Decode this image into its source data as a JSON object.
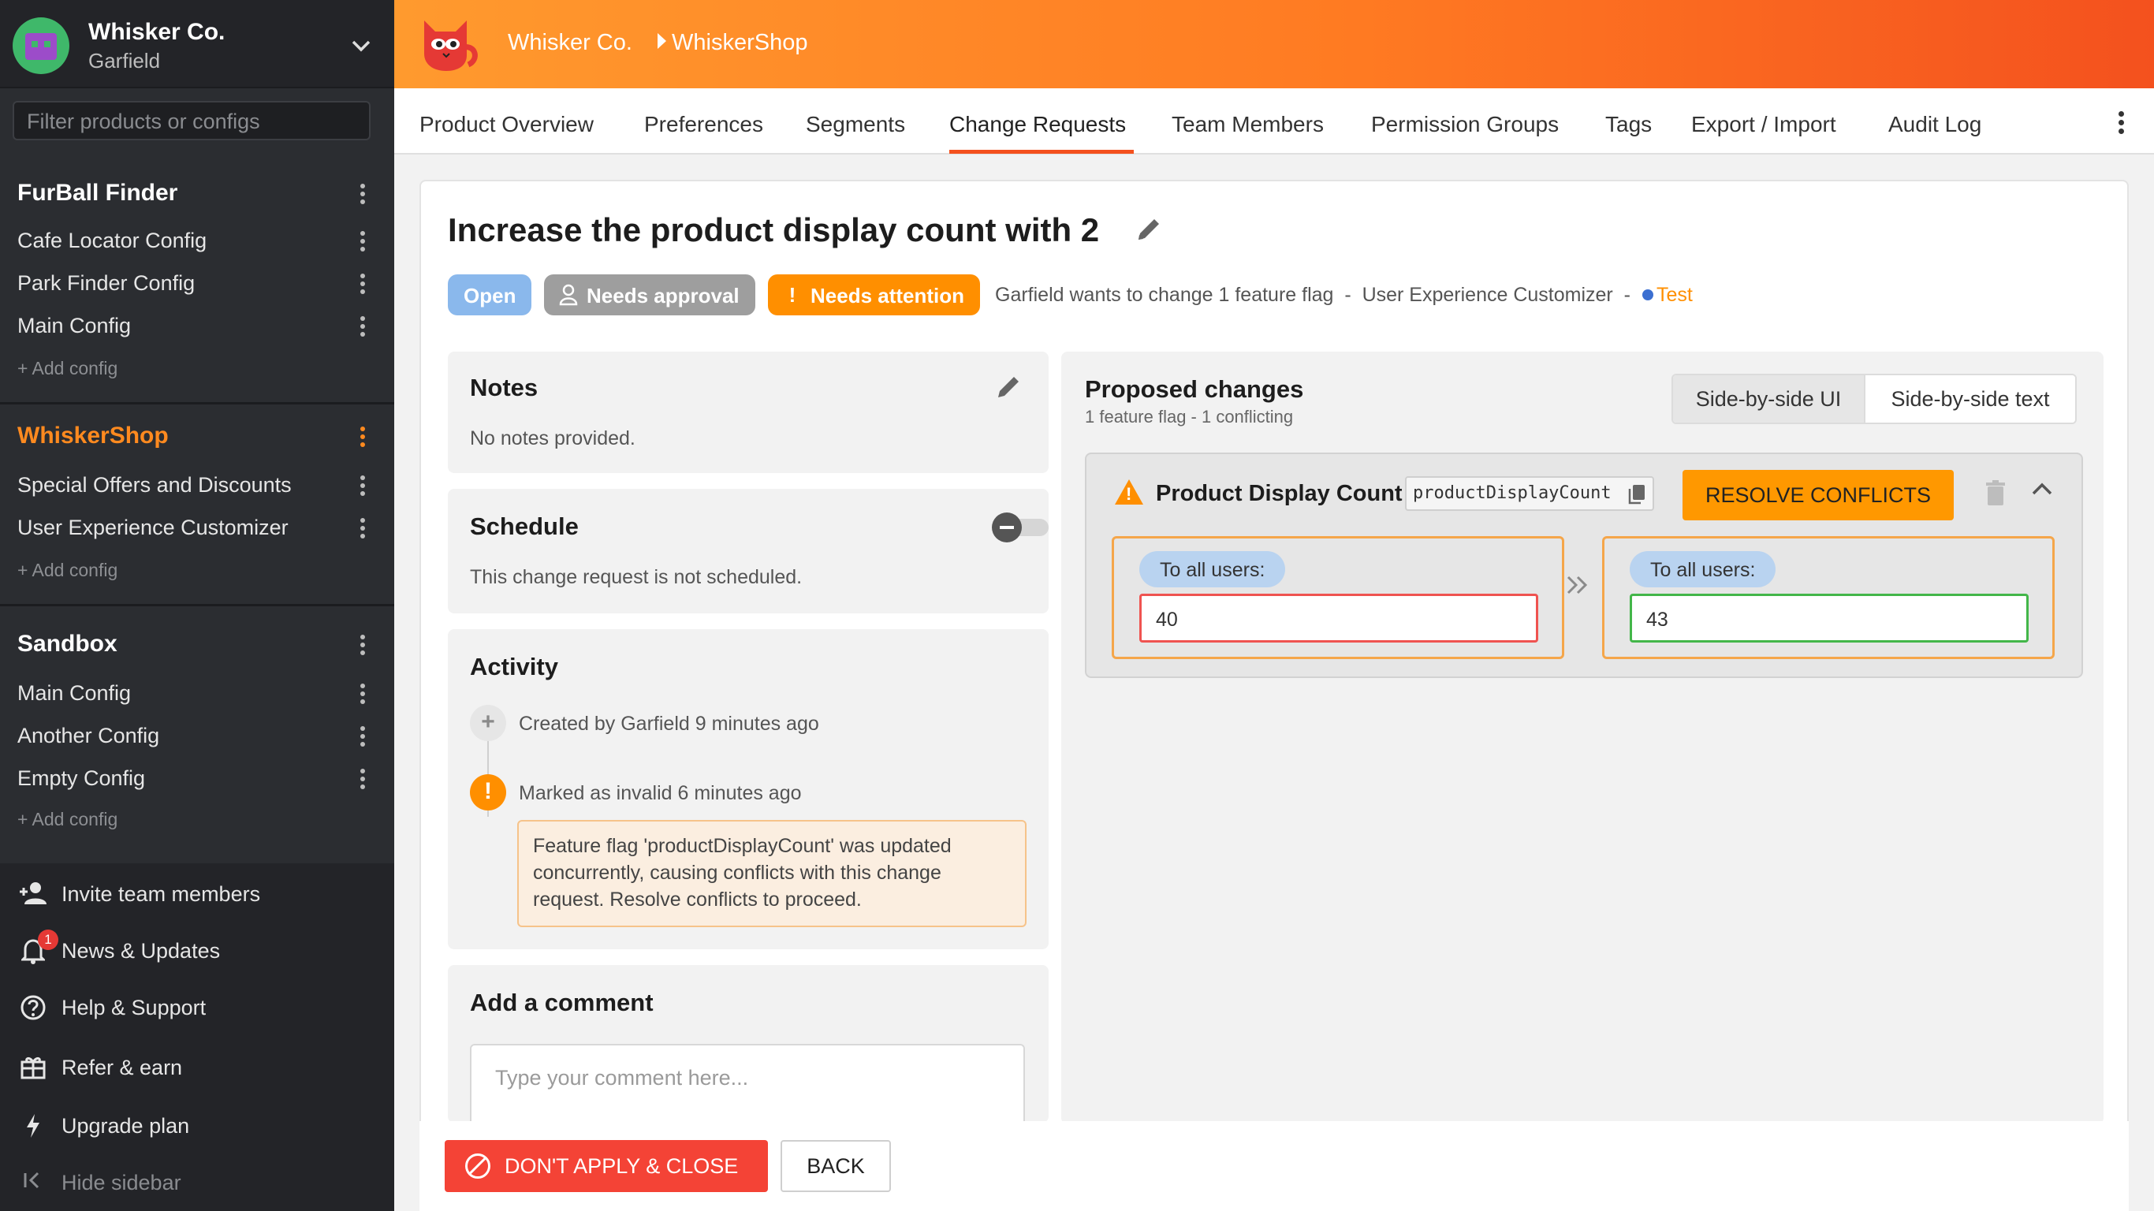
{
  "sidebar": {
    "org_name": "Whisker Co.",
    "user_name": "Garfield",
    "filter_placeholder": "Filter products or configs",
    "products": [
      {
        "name": "FurBall Finder",
        "active": false,
        "configs": [
          "Cafe Locator Config",
          "Park Finder Config",
          "Main Config"
        ],
        "add_label": "+ Add config"
      },
      {
        "name": "WhiskerShop",
        "active": true,
        "configs": [
          "Special Offers and Discounts",
          "User Experience Customizer"
        ],
        "add_label": "+ Add config"
      },
      {
        "name": "Sandbox",
        "active": false,
        "configs": [
          "Main Config",
          "Another Config",
          "Empty Config"
        ],
        "add_label": "+ Add config"
      }
    ],
    "bottom_nav": [
      {
        "label": "Invite team members",
        "icon": "person-add-icon"
      },
      {
        "label": "News & Updates",
        "icon": "bell-icon",
        "badge": "1"
      },
      {
        "label": "Help & Support",
        "icon": "help-circle-icon"
      },
      {
        "label": "Refer & earn",
        "icon": "gift-icon"
      },
      {
        "label": "Upgrade plan",
        "icon": "lightning-icon"
      },
      {
        "label": "Hide sidebar",
        "icon": "collapse-left-icon"
      }
    ]
  },
  "header": {
    "breadcrumb": [
      "Whisker Co.",
      "WhiskerShop"
    ],
    "accent_color": "#ff7a22"
  },
  "tabs": {
    "items": [
      "Product Overview",
      "Preferences",
      "Segments",
      "Change Requests",
      "Team Members",
      "Permission Groups",
      "Tags",
      "Export / Import",
      "Audit Log"
    ],
    "active": "Change Requests"
  },
  "change_request": {
    "title": "Increase the product display count with 2",
    "status_badges": [
      "Open",
      "Needs approval",
      "Needs attention"
    ],
    "meta": "Garfield wants to change 1 feature flag",
    "meta_sep1": "-",
    "meta_config": "User Experience Customizer",
    "meta_sep2": "-",
    "meta_env": "Test",
    "notes": {
      "title": "Notes",
      "text": "No notes provided."
    },
    "schedule": {
      "title": "Schedule",
      "text": "This change request is not scheduled.",
      "enabled": false
    },
    "activity": {
      "title": "Activity",
      "items": [
        {
          "text": "Created by Garfield 9 minutes ago",
          "icon": "plus-icon"
        },
        {
          "text": "Marked as invalid 6 minutes ago",
          "icon": "warning-icon",
          "note": "Feature flag 'productDisplayCount' was updated concurrently, causing conflicts with this change request. Resolve conflicts to proceed."
        }
      ]
    },
    "comment": {
      "title": "Add a comment",
      "placeholder": "Type your comment here..."
    },
    "proposed": {
      "title": "Proposed changes",
      "subtitle": "1 feature flag - 1 conflicting",
      "view_modes": [
        "Side-by-side UI",
        "Side-by-side text"
      ],
      "active_view": "Side-by-side UI",
      "flag": {
        "name": "Product Display Count",
        "key": "productDisplayCount",
        "resolve_label": "RESOLVE CONFLICTS",
        "left": {
          "label": "To all users:",
          "value": "40"
        },
        "right": {
          "label": "To all users:",
          "value": "43"
        }
      }
    },
    "actions": {
      "reject_label": "DON'T APPLY & CLOSE",
      "back_label": "BACK"
    }
  }
}
